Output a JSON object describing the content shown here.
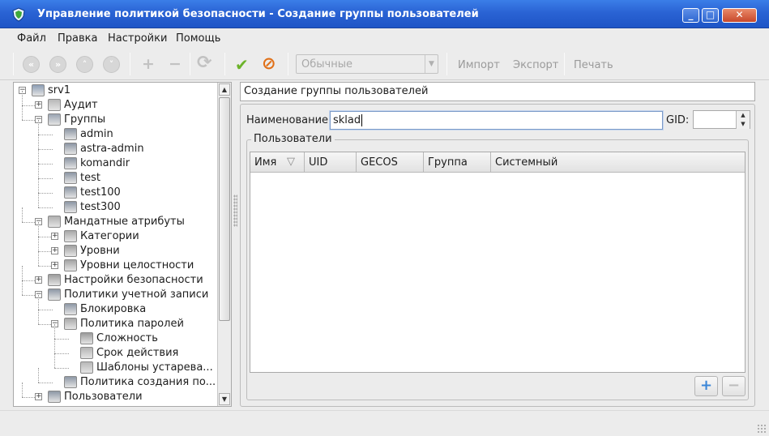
{
  "window": {
    "title": "Управление политикой безопасности - Создание группы пользователей",
    "controls": [
      "_",
      "□",
      "✕"
    ]
  },
  "menu": [
    "Файл",
    "Правка",
    "Настройки",
    "Помощь"
  ],
  "toolbar": {
    "nav_buttons": [
      "first-icon",
      "last-icon",
      "up-icon",
      "down-icon"
    ],
    "add_label": "+",
    "remove_label": "−",
    "refresh_label": "⟳",
    "apply_label": "✔",
    "cancel_label": "⊘",
    "filter_combo_value": "Обычные",
    "import_label": "Импорт",
    "export_label": "Экспорт",
    "print_label": "Печать",
    "accent_colors": {
      "apply": "#6cb32a",
      "cancel": "#e07018"
    }
  },
  "tree": [
    {
      "label": "srv1",
      "level": 0,
      "icon": "computer-icon",
      "expander": "−"
    },
    {
      "label": "Аудит",
      "level": 1,
      "icon": "audit-icon",
      "expander": "+"
    },
    {
      "label": "Группы",
      "level": 1,
      "icon": "groups-icon",
      "expander": "−"
    },
    {
      "label": "admin",
      "level": 2,
      "icon": "user-icon",
      "expander": ""
    },
    {
      "label": "astra-admin",
      "level": 2,
      "icon": "user-icon",
      "expander": ""
    },
    {
      "label": "komandir",
      "level": 2,
      "icon": "user-icon",
      "expander": ""
    },
    {
      "label": "test",
      "level": 2,
      "icon": "user-icon",
      "expander": ""
    },
    {
      "label": "test100",
      "level": 2,
      "icon": "user-icon",
      "expander": ""
    },
    {
      "label": "test300",
      "level": 2,
      "icon": "user-icon",
      "expander": ""
    },
    {
      "label": "Мандатные атрибуты",
      "level": 1,
      "icon": "mandatory-icon",
      "expander": "−"
    },
    {
      "label": "Категории",
      "level": 2,
      "icon": "category-icon",
      "expander": "+"
    },
    {
      "label": "Уровни",
      "level": 2,
      "icon": "levels-icon",
      "expander": "+"
    },
    {
      "label": "Уровни целостности",
      "level": 2,
      "icon": "integrity-icon",
      "expander": "+"
    },
    {
      "label": "Настройки безопасности",
      "level": 1,
      "icon": "tools-icon",
      "expander": "+"
    },
    {
      "label": "Политики учетной записи",
      "level": 1,
      "icon": "account-policy-icon",
      "expander": "−"
    },
    {
      "label": "Блокировка",
      "level": 2,
      "icon": "lock-user-icon",
      "expander": ""
    },
    {
      "label": "Политика паролей",
      "level": 2,
      "icon": "password-policy-icon",
      "expander": "−"
    },
    {
      "label": "Сложность",
      "level": 3,
      "icon": "complexity-icon",
      "expander": ""
    },
    {
      "label": "Срок действия",
      "level": 3,
      "icon": "expiry-icon",
      "expander": ""
    },
    {
      "label": "Шаблоны устарева...",
      "level": 3,
      "icon": "template-icon",
      "expander": ""
    },
    {
      "label": "Политика создания по...",
      "level": 2,
      "icon": "creation-policy-icon",
      "expander": ""
    },
    {
      "label": "Пользователи",
      "level": 1,
      "icon": "users-icon",
      "expander": "+"
    }
  ],
  "form": {
    "header": "Создание группы пользователей",
    "name_label": "Наименование:",
    "name_value": "sklad",
    "gid_label": "GID:",
    "gid_value": "",
    "users_group_label": "Пользователи",
    "columns": [
      "Имя",
      "UID",
      "GECOS",
      "Группа",
      "Системный"
    ],
    "rows": [],
    "add_user_label": "+",
    "remove_user_label": "−"
  }
}
